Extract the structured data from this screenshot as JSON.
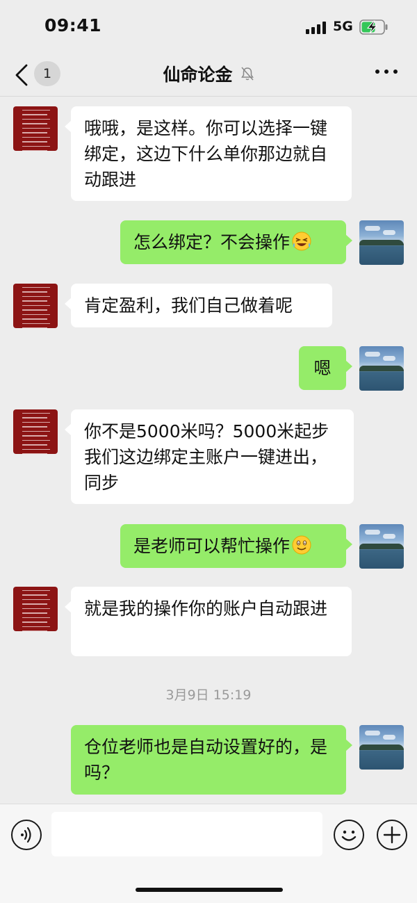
{
  "status": {
    "time": "09:41",
    "network": "5G",
    "signal_bars": 4,
    "battery_charging": true
  },
  "nav": {
    "back_count": "1",
    "title": "仙命论金",
    "muted": true
  },
  "messages": [
    {
      "side": "in",
      "text": "哦哦，是这样。你可以选择一键绑定，这边下什么单你那边就自动跟进"
    },
    {
      "side": "out",
      "text": "怎么绑定？不会操作",
      "emoji": "rolling-laughing-emoji"
    },
    {
      "side": "in",
      "text": "肯定盈利，我们自己做着呢"
    },
    {
      "side": "out",
      "text": "嗯"
    },
    {
      "side": "in",
      "text": "你不是5000米吗？5000米起步我们这边绑定主账户一键进出，同步"
    },
    {
      "side": "out",
      "text": "是老师可以帮忙操作",
      "emoji": "smile-emoji"
    },
    {
      "side": "in",
      "text": "就是我的操作你的账户自动跟进"
    },
    {
      "side": "out",
      "text": "仓位老师也是自动设置好的，是吗？"
    }
  ],
  "timestamp": "3月9日 15:19",
  "input": {
    "value": ""
  },
  "colors": {
    "background": "#ededed",
    "incoming_bubble": "#ffffff",
    "outgoing_bubble": "#95ec69"
  }
}
